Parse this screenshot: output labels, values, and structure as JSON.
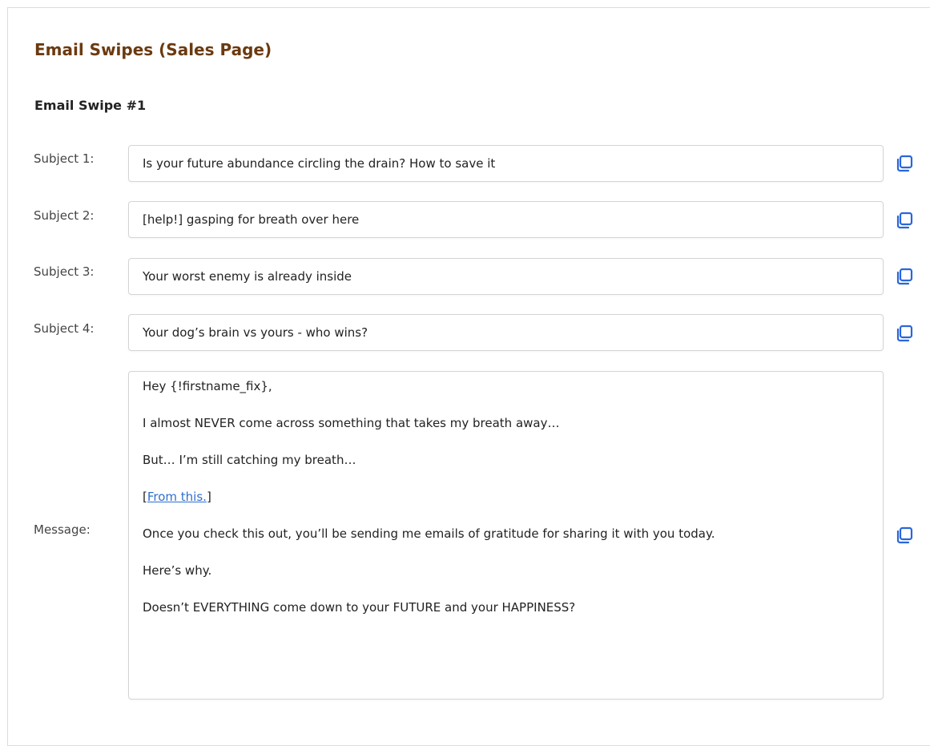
{
  "header": {
    "title": "Email Swipes (Sales Page)"
  },
  "swipe": {
    "title": "Email Swipe #1",
    "subjects": [
      {
        "label": "Subject 1:",
        "value": "Is your future abundance circling the drain? How to save it"
      },
      {
        "label": "Subject 2:",
        "value": "[help!] gasping for breath over here"
      },
      {
        "label": "Subject 3:",
        "value": "Your worst enemy is already inside"
      },
      {
        "label": "Subject 4:",
        "value": "Your dog’s brain vs yours - who wins?"
      }
    ],
    "message": {
      "label": "Message:",
      "greeting": "Hey {!firstname_fix},",
      "line1": "I almost NEVER come across something that takes my breath away…",
      "line2": "But… I’m still catching my breath…",
      "link_open": "[",
      "link_text": "From this.",
      "link_close": "]",
      "line3": "Once you check this out, you’ll be sending me emails of gratitude for sharing it with you today.",
      "line4": "Here’s why.",
      "line5": "Doesn’t EVERYTHING come down to your FUTURE and your HAPPINESS?"
    }
  },
  "icons": {
    "copy": "copy-icon"
  },
  "colors": {
    "title": "#6b3a10",
    "icon": "#2a66d9",
    "link": "#2f6fcf"
  }
}
